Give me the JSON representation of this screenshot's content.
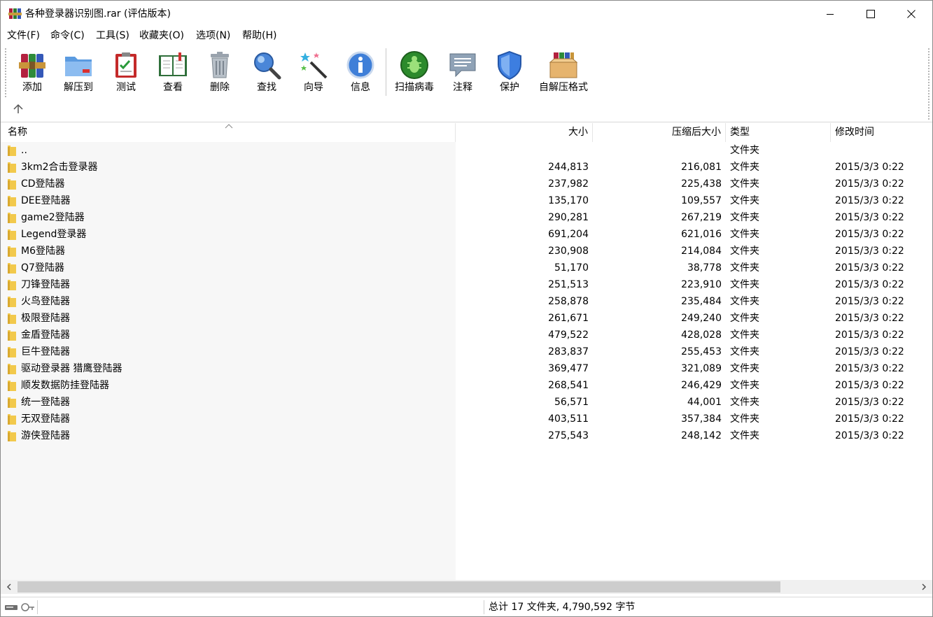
{
  "window": {
    "title": "各种登录器识别图.rar (评估版本)"
  },
  "menu": [
    "文件(F)",
    "命令(C)",
    "工具(S)",
    "收藏夹(O)",
    "选项(N)",
    "帮助(H)"
  ],
  "toolbar": {
    "buttons": [
      {
        "label": "添加",
        "icon": "add-archive-icon"
      },
      {
        "label": "解压到",
        "icon": "extract-folder-icon"
      },
      {
        "label": "测试",
        "icon": "test-clipboard-icon"
      },
      {
        "label": "查看",
        "icon": "view-book-icon"
      },
      {
        "label": "删除",
        "icon": "delete-trash-icon"
      },
      {
        "label": "查找",
        "icon": "find-magnifier-icon"
      },
      {
        "label": "向导",
        "icon": "wizard-wand-icon"
      },
      {
        "label": "信息",
        "icon": "info-icon"
      },
      {
        "label": "扫描病毒",
        "icon": "scan-virus-bug-icon"
      },
      {
        "label": "注释",
        "icon": "comment-icon"
      },
      {
        "label": "保护",
        "icon": "protect-shield-icon"
      },
      {
        "label": "自解压格式",
        "icon": "sfx-box-icon"
      }
    ]
  },
  "columns": {
    "name": "名称",
    "size": "大小",
    "packed": "压缩后大小",
    "type": "类型",
    "modified": "修改时间"
  },
  "files": [
    {
      "name": "..",
      "size": "",
      "packed": "",
      "type": "文件夹",
      "modified": ""
    },
    {
      "name": "3km2合击登录器",
      "size": "244,813",
      "packed": "216,081",
      "type": "文件夹",
      "modified": "2015/3/3 0:22"
    },
    {
      "name": "CD登陆器",
      "size": "237,982",
      "packed": "225,438",
      "type": "文件夹",
      "modified": "2015/3/3 0:22"
    },
    {
      "name": "DEE登陆器",
      "size": "135,170",
      "packed": "109,557",
      "type": "文件夹",
      "modified": "2015/3/3 0:22"
    },
    {
      "name": "game2登陆器",
      "size": "290,281",
      "packed": "267,219",
      "type": "文件夹",
      "modified": "2015/3/3 0:22"
    },
    {
      "name": "Legend登录器",
      "size": "691,204",
      "packed": "621,016",
      "type": "文件夹",
      "modified": "2015/3/3 0:22"
    },
    {
      "name": "M6登陆器",
      "size": "230,908",
      "packed": "214,084",
      "type": "文件夹",
      "modified": "2015/3/3 0:22"
    },
    {
      "name": "Q7登陆器",
      "size": "51,170",
      "packed": "38,778",
      "type": "文件夹",
      "modified": "2015/3/3 0:22"
    },
    {
      "name": "刀锋登陆器",
      "size": "251,513",
      "packed": "223,910",
      "type": "文件夹",
      "modified": "2015/3/3 0:22"
    },
    {
      "name": "火鸟登陆器",
      "size": "258,878",
      "packed": "235,484",
      "type": "文件夹",
      "modified": "2015/3/3 0:22"
    },
    {
      "name": "极限登陆器",
      "size": "261,671",
      "packed": "249,240",
      "type": "文件夹",
      "modified": "2015/3/3 0:22"
    },
    {
      "name": "金盾登陆器",
      "size": "479,522",
      "packed": "428,028",
      "type": "文件夹",
      "modified": "2015/3/3 0:22"
    },
    {
      "name": "巨牛登陆器",
      "size": "283,837",
      "packed": "255,453",
      "type": "文件夹",
      "modified": "2015/3/3 0:22"
    },
    {
      "name": "驱动登录器 猎鹰登陆器",
      "size": "369,477",
      "packed": "321,089",
      "type": "文件夹",
      "modified": "2015/3/3 0:22"
    },
    {
      "name": "顺发数据防挂登陆器",
      "size": "268,541",
      "packed": "246,429",
      "type": "文件夹",
      "modified": "2015/3/3 0:22"
    },
    {
      "name": "统一登陆器",
      "size": "56,571",
      "packed": "44,001",
      "type": "文件夹",
      "modified": "2015/3/3 0:22"
    },
    {
      "name": "无双登陆器",
      "size": "403,511",
      "packed": "357,384",
      "type": "文件夹",
      "modified": "2015/3/3 0:22"
    },
    {
      "name": "游侠登陆器",
      "size": "275,543",
      "packed": "248,142",
      "type": "文件夹",
      "modified": "2015/3/3 0:22"
    }
  ],
  "status": {
    "summary": "总计 17 文件夹, 4,790,592 字节"
  },
  "colors": {
    "folder": "#f2c94c",
    "name_column_bg": "#f7f7f7",
    "scroll_thumb": "#cdcdcd"
  }
}
